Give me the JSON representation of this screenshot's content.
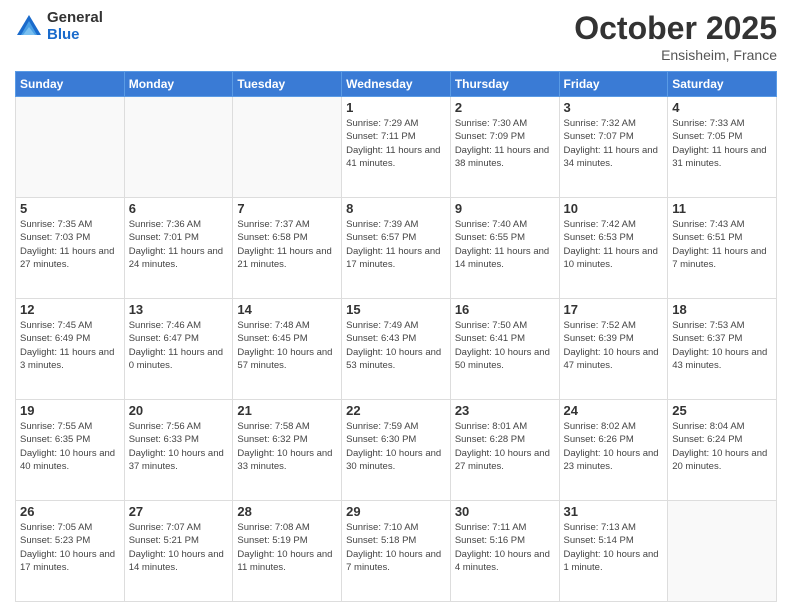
{
  "logo": {
    "general": "General",
    "blue": "Blue"
  },
  "title": {
    "month_year": "October 2025",
    "location": "Ensisheim, France"
  },
  "weekdays": [
    "Sunday",
    "Monday",
    "Tuesday",
    "Wednesday",
    "Thursday",
    "Friday",
    "Saturday"
  ],
  "weeks": [
    [
      {
        "day": "",
        "info": ""
      },
      {
        "day": "",
        "info": ""
      },
      {
        "day": "",
        "info": ""
      },
      {
        "day": "1",
        "info": "Sunrise: 7:29 AM\nSunset: 7:11 PM\nDaylight: 11 hours\nand 41 minutes."
      },
      {
        "day": "2",
        "info": "Sunrise: 7:30 AM\nSunset: 7:09 PM\nDaylight: 11 hours\nand 38 minutes."
      },
      {
        "day": "3",
        "info": "Sunrise: 7:32 AM\nSunset: 7:07 PM\nDaylight: 11 hours\nand 34 minutes."
      },
      {
        "day": "4",
        "info": "Sunrise: 7:33 AM\nSunset: 7:05 PM\nDaylight: 11 hours\nand 31 minutes."
      }
    ],
    [
      {
        "day": "5",
        "info": "Sunrise: 7:35 AM\nSunset: 7:03 PM\nDaylight: 11 hours\nand 27 minutes."
      },
      {
        "day": "6",
        "info": "Sunrise: 7:36 AM\nSunset: 7:01 PM\nDaylight: 11 hours\nand 24 minutes."
      },
      {
        "day": "7",
        "info": "Sunrise: 7:37 AM\nSunset: 6:58 PM\nDaylight: 11 hours\nand 21 minutes."
      },
      {
        "day": "8",
        "info": "Sunrise: 7:39 AM\nSunset: 6:57 PM\nDaylight: 11 hours\nand 17 minutes."
      },
      {
        "day": "9",
        "info": "Sunrise: 7:40 AM\nSunset: 6:55 PM\nDaylight: 11 hours\nand 14 minutes."
      },
      {
        "day": "10",
        "info": "Sunrise: 7:42 AM\nSunset: 6:53 PM\nDaylight: 11 hours\nand 10 minutes."
      },
      {
        "day": "11",
        "info": "Sunrise: 7:43 AM\nSunset: 6:51 PM\nDaylight: 11 hours\nand 7 minutes."
      }
    ],
    [
      {
        "day": "12",
        "info": "Sunrise: 7:45 AM\nSunset: 6:49 PM\nDaylight: 11 hours\nand 3 minutes."
      },
      {
        "day": "13",
        "info": "Sunrise: 7:46 AM\nSunset: 6:47 PM\nDaylight: 11 hours\nand 0 minutes."
      },
      {
        "day": "14",
        "info": "Sunrise: 7:48 AM\nSunset: 6:45 PM\nDaylight: 10 hours\nand 57 minutes."
      },
      {
        "day": "15",
        "info": "Sunrise: 7:49 AM\nSunset: 6:43 PM\nDaylight: 10 hours\nand 53 minutes."
      },
      {
        "day": "16",
        "info": "Sunrise: 7:50 AM\nSunset: 6:41 PM\nDaylight: 10 hours\nand 50 minutes."
      },
      {
        "day": "17",
        "info": "Sunrise: 7:52 AM\nSunset: 6:39 PM\nDaylight: 10 hours\nand 47 minutes."
      },
      {
        "day": "18",
        "info": "Sunrise: 7:53 AM\nSunset: 6:37 PM\nDaylight: 10 hours\nand 43 minutes."
      }
    ],
    [
      {
        "day": "19",
        "info": "Sunrise: 7:55 AM\nSunset: 6:35 PM\nDaylight: 10 hours\nand 40 minutes."
      },
      {
        "day": "20",
        "info": "Sunrise: 7:56 AM\nSunset: 6:33 PM\nDaylight: 10 hours\nand 37 minutes."
      },
      {
        "day": "21",
        "info": "Sunrise: 7:58 AM\nSunset: 6:32 PM\nDaylight: 10 hours\nand 33 minutes."
      },
      {
        "day": "22",
        "info": "Sunrise: 7:59 AM\nSunset: 6:30 PM\nDaylight: 10 hours\nand 30 minutes."
      },
      {
        "day": "23",
        "info": "Sunrise: 8:01 AM\nSunset: 6:28 PM\nDaylight: 10 hours\nand 27 minutes."
      },
      {
        "day": "24",
        "info": "Sunrise: 8:02 AM\nSunset: 6:26 PM\nDaylight: 10 hours\nand 23 minutes."
      },
      {
        "day": "25",
        "info": "Sunrise: 8:04 AM\nSunset: 6:24 PM\nDaylight: 10 hours\nand 20 minutes."
      }
    ],
    [
      {
        "day": "26",
        "info": "Sunrise: 7:05 AM\nSunset: 5:23 PM\nDaylight: 10 hours\nand 17 minutes."
      },
      {
        "day": "27",
        "info": "Sunrise: 7:07 AM\nSunset: 5:21 PM\nDaylight: 10 hours\nand 14 minutes."
      },
      {
        "day": "28",
        "info": "Sunrise: 7:08 AM\nSunset: 5:19 PM\nDaylight: 10 hours\nand 11 minutes."
      },
      {
        "day": "29",
        "info": "Sunrise: 7:10 AM\nSunset: 5:18 PM\nDaylight: 10 hours\nand 7 minutes."
      },
      {
        "day": "30",
        "info": "Sunrise: 7:11 AM\nSunset: 5:16 PM\nDaylight: 10 hours\nand 4 minutes."
      },
      {
        "day": "31",
        "info": "Sunrise: 7:13 AM\nSunset: 5:14 PM\nDaylight: 10 hours\nand 1 minute."
      },
      {
        "day": "",
        "info": ""
      }
    ]
  ]
}
